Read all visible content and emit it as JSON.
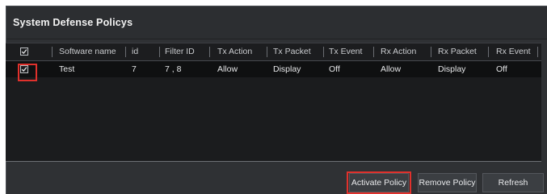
{
  "panel": {
    "title": "System Defense Policys"
  },
  "table": {
    "columns": [
      "Software name",
      "id",
      "Filter ID",
      "Tx Action",
      "Tx Packet",
      "Tx Event",
      "Rx Action",
      "Rx Packet",
      "Rx Event"
    ],
    "rows": [
      {
        "checked": true,
        "software_name": "Test",
        "id": "7",
        "filter_id": "7 , 8",
        "tx_action": "Allow",
        "tx_packet": "Display",
        "tx_event": "Off",
        "rx_action": "Allow",
        "rx_packet": "Display",
        "rx_event": "Off"
      }
    ],
    "select_all_checked": true
  },
  "buttons": {
    "activate": "Activate Policy",
    "remove": "Remove Policy",
    "refresh": "Refresh"
  },
  "colors": {
    "highlight": "#e0312c",
    "panel_bg": "#2f3134",
    "grid_bg": "#1b1c1e"
  }
}
